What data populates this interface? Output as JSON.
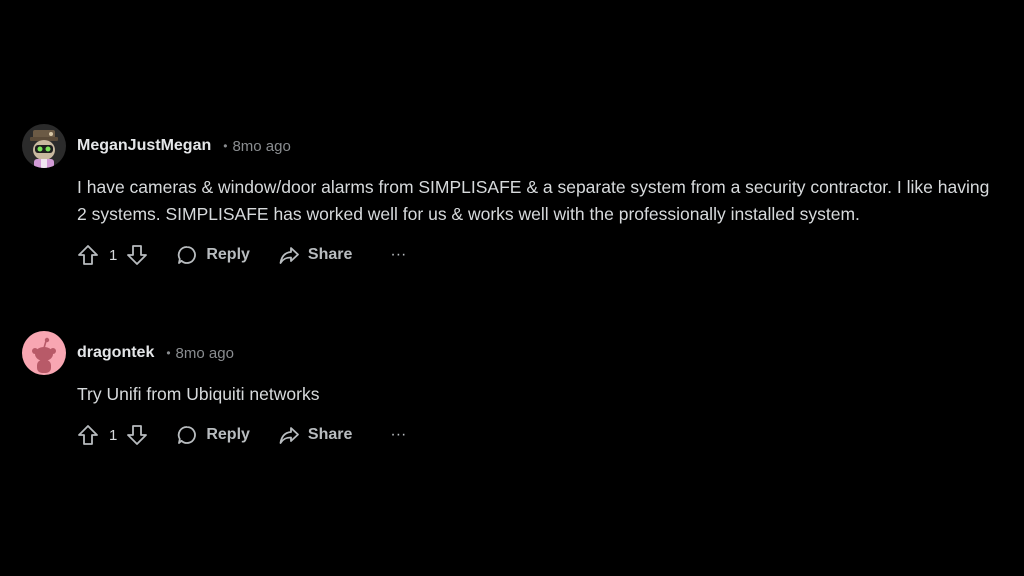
{
  "comments": [
    {
      "username": "MeganJustMegan",
      "separator": "•",
      "timestamp": "8mo ago",
      "avatar": "avatar-icon-character",
      "body": "I have cameras & window/door alarms from SIMPLISAFE & a separate system from a security contractor. I like having 2 systems. SIMPLISAFE has worked well for us & works well with the professionally installed system.",
      "score": "1",
      "reply_label": "Reply",
      "share_label": "Share",
      "more_label": "···"
    },
    {
      "username": "dragontek",
      "separator": "•",
      "timestamp": "8mo ago",
      "avatar": "avatar-icon-snoo",
      "body": "Try Unifi from Ubiquiti networks",
      "score": "1",
      "reply_label": "Reply",
      "share_label": "Share",
      "more_label": "···"
    }
  ],
  "colors": {
    "background": "#000000",
    "text": "#d7dadc",
    "muted": "#8a8d90",
    "snoo_avatar_bg": "#f8a6b2"
  }
}
